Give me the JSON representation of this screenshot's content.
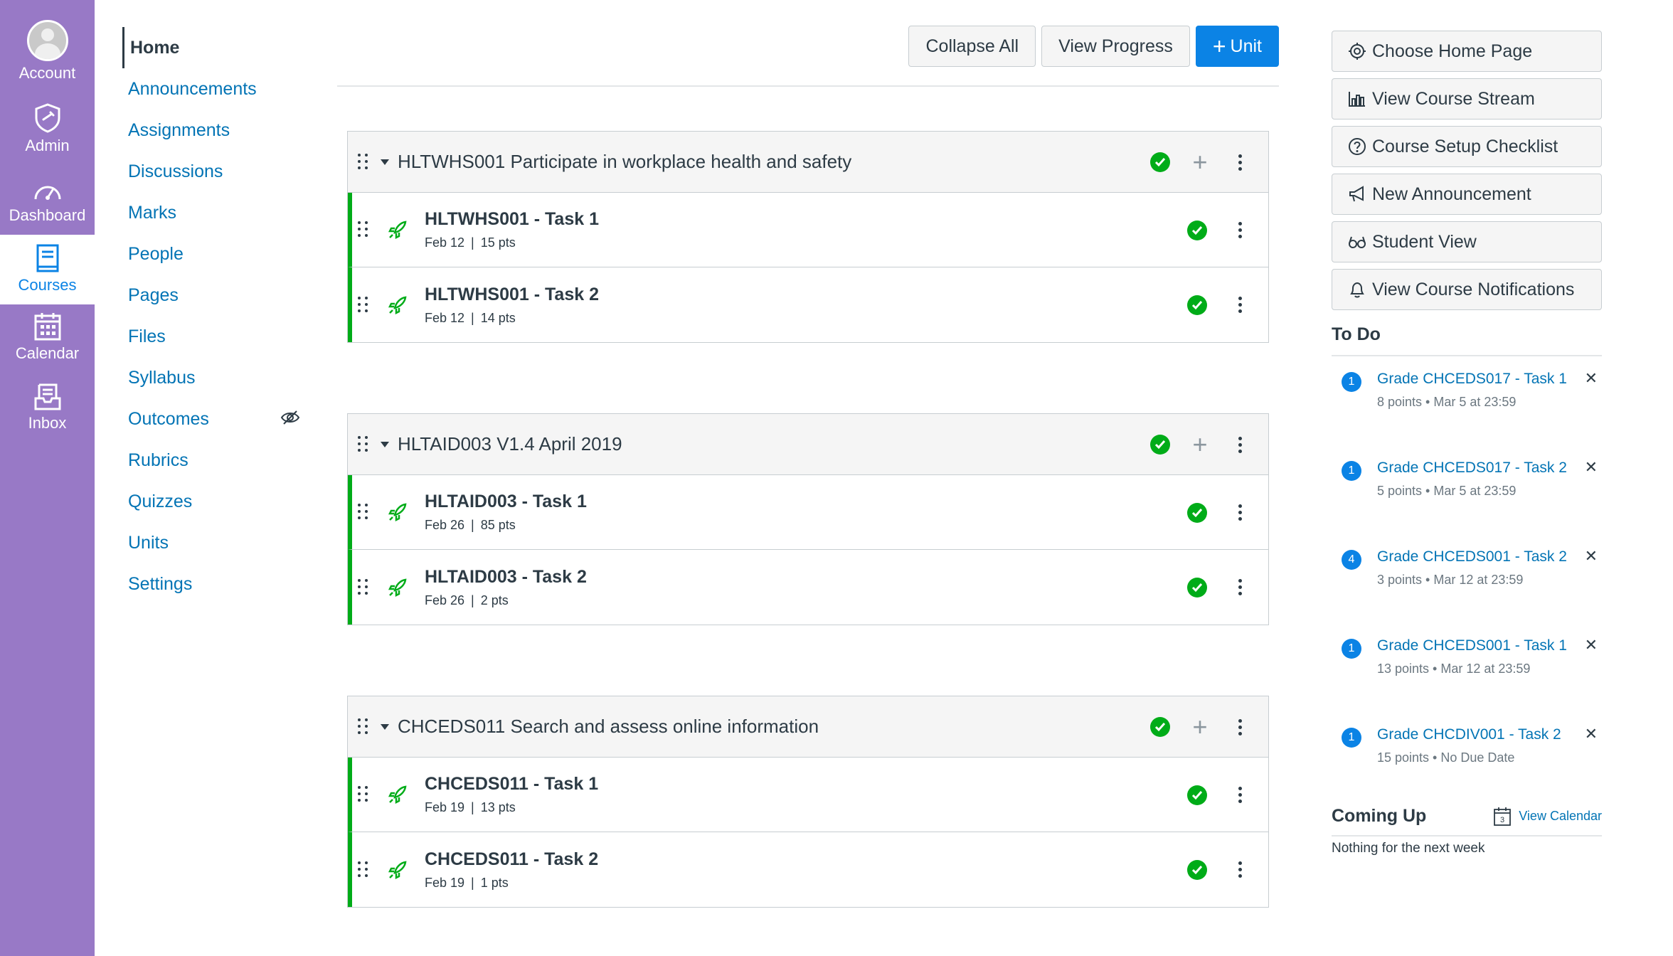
{
  "global_nav": {
    "account": "Account",
    "admin": "Admin",
    "dashboard": "Dashboard",
    "courses": "Courses",
    "calendar": "Calendar",
    "inbox": "Inbox",
    "bg_color": "#9879c6"
  },
  "course_nav": {
    "items": [
      {
        "label": "Home"
      },
      {
        "label": "Announcements"
      },
      {
        "label": "Assignments"
      },
      {
        "label": "Discussions"
      },
      {
        "label": "Marks"
      },
      {
        "label": "People"
      },
      {
        "label": "Pages"
      },
      {
        "label": "Files"
      },
      {
        "label": "Syllabus"
      },
      {
        "label": "Outcomes"
      },
      {
        "label": "Rubrics"
      },
      {
        "label": "Quizzes"
      },
      {
        "label": "Units"
      },
      {
        "label": "Settings"
      }
    ]
  },
  "toolbar": {
    "collapse_all": "Collapse All",
    "view_progress": "View Progress",
    "add_unit": "Unit"
  },
  "modules": [
    {
      "title": "HLTWHS001 Participate in workplace health and safety",
      "items": [
        {
          "title": "HLTWHS001 - Task 1",
          "date": "Feb 12",
          "points": "15 pts"
        },
        {
          "title": "HLTWHS001 - Task 2",
          "date": "Feb 12",
          "points": "14 pts"
        }
      ]
    },
    {
      "title": "HLTAID003 V1.4 April 2019",
      "items": [
        {
          "title": "HLTAID003 - Task 1",
          "date": "Feb 26",
          "points": "85 pts"
        },
        {
          "title": "HLTAID003 - Task 2",
          "date": "Feb 26",
          "points": "2 pts"
        }
      ]
    },
    {
      "title": "CHCEDS011 Search and assess online information",
      "items": [
        {
          "title": "CHCEDS011 - Task 1",
          "date": "Feb 19",
          "points": "13 pts"
        },
        {
          "title": "CHCEDS011 - Task 2",
          "date": "Feb 19",
          "points": "1 pts"
        }
      ]
    }
  ],
  "sidebar": {
    "buttons": [
      {
        "label": "Choose Home Page",
        "icon": "gear-icon"
      },
      {
        "label": "View Course Stream",
        "icon": "stream-icon"
      },
      {
        "label": "Course Setup Checklist",
        "icon": "question-icon"
      },
      {
        "label": "New Announcement",
        "icon": "megaphone-icon"
      },
      {
        "label": "Student View",
        "icon": "glasses-icon"
      },
      {
        "label": "View Course Notifications",
        "icon": "bell-icon"
      }
    ],
    "todo_heading": "To Do",
    "todo": [
      {
        "badge": "1",
        "title": "Grade CHCEDS017 - Task 1",
        "meta": "8 points • Mar 5 at 23:59"
      },
      {
        "badge": "1",
        "title": "Grade CHCEDS017 - Task 2",
        "meta": "5 points • Mar 5 at 23:59"
      },
      {
        "badge": "4",
        "title": "Grade CHCEDS001 - Task 2",
        "meta": "3 points • Mar 12 at 23:59"
      },
      {
        "badge": "1",
        "title": "Grade CHCEDS001 - Task 1",
        "meta": "13 points • Mar 12 at 23:59"
      },
      {
        "badge": "1",
        "title": "Grade CHCDIV001 - Task 2",
        "meta": "15 points • No Due Date"
      }
    ],
    "coming_up_heading": "Coming Up",
    "view_calendar": "View Calendar",
    "calendar_day": "3",
    "coming_up_empty": "Nothing for the next week"
  },
  "colors": {
    "accent": "#0b83e5",
    "link": "#0374b5",
    "success": "#00ac18",
    "nav": "#9879c6"
  }
}
